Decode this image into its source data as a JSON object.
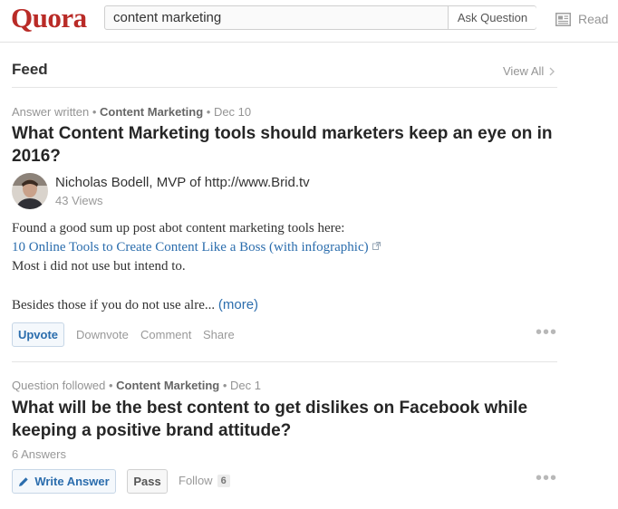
{
  "header": {
    "logo": "Quora",
    "search": {
      "value": "content marketing",
      "placeholder": ""
    },
    "ask_button": "Ask Question",
    "read_label": "Read"
  },
  "feed": {
    "title": "Feed",
    "view_all": "View All"
  },
  "story1": {
    "meta_prefix": "Answer written",
    "meta_topic": "Content Marketing",
    "meta_date": "Dec 10",
    "question": "What Content Marketing tools should marketers keep an eye on in 2016?",
    "author": "Nicholas Bodell, MVP of http://www.Brid.tv",
    "views": "43 Views",
    "line1": "Found a good sum up post abot content marketing tools here:",
    "link_text": "10 Online Tools to Create Content Like a Boss (with infographic)",
    "line3": "Most i did not use but intend to.",
    "line4": "Besides those if you do not use alre...",
    "more": "(more)",
    "actions": {
      "upvote": "Upvote",
      "downvote": "Downvote",
      "comment": "Comment",
      "share": "Share",
      "more_dots": "•••"
    }
  },
  "story2": {
    "meta_prefix": "Question followed",
    "meta_topic": "Content Marketing",
    "meta_date": "Dec 1",
    "question": "What will be the best content to get dislikes on Facebook while keeping a positive brand attitude?",
    "answers": "6 Answers",
    "actions": {
      "write_answer": "Write Answer",
      "pass": "Pass",
      "follow": "Follow",
      "follow_count": "6",
      "more_dots": "•••"
    }
  },
  "icons": {
    "read": "newspaper-icon",
    "chevron": "chevron-right-icon",
    "external": "external-link-icon",
    "pencil": "pencil-icon"
  },
  "colors": {
    "brand": "#b92b27",
    "link": "#2b6dad",
    "muted": "#949494"
  }
}
